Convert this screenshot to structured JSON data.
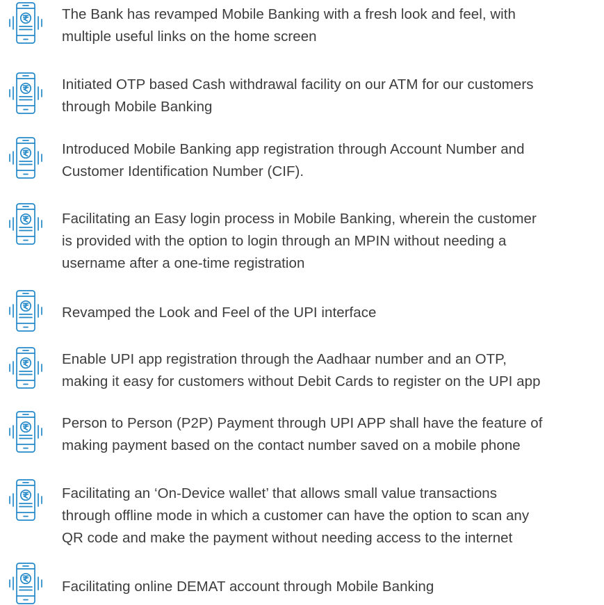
{
  "accent_color": "#2489c9",
  "text_color": "#3d3d3d",
  "icon_name": "mobile-banking-rupee-icon",
  "features": [
    {
      "lines": [
        "The Bank has revamped Mobile Banking with a fresh look and feel, with",
        "multiple useful links on the home screen"
      ]
    },
    {
      "lines": [
        "Initiated OTP based Cash withdrawal facility on our ATM for our customers",
        "through Mobile Banking"
      ]
    },
    {
      "lines": [
        "Introduced Mobile Banking app registration through Account Number and",
        "Customer Identification Number (CIF)."
      ]
    },
    {
      "lines": [
        "Facilitating an Easy login process in Mobile Banking, wherein the customer",
        "is provided with the option to login through an MPIN without needing a",
        "username after a one-time registration"
      ]
    },
    {
      "lines": [
        "Revamped the Look and Feel of the UPI interface"
      ]
    },
    {
      "lines": [
        "Enable UPI app registration through the Aadhaar number and an OTP,",
        "making it easy for customers without Debit Cards to register on the UPI app"
      ]
    },
    {
      "lines": [
        "Person to Person (P2P) Payment through UPI APP shall have the feature of",
        "making payment based on the contact number saved on a mobile phone"
      ]
    },
    {
      "lines": [
        "Facilitating an ‘On-Device wallet’ that allows small value transactions",
        "through offline mode in which a customer can have the option to scan any",
        "QR code and make the payment without needing access to the internet"
      ]
    },
    {
      "lines": [
        "Facilitating online DEMAT account through Mobile Banking"
      ]
    }
  ]
}
